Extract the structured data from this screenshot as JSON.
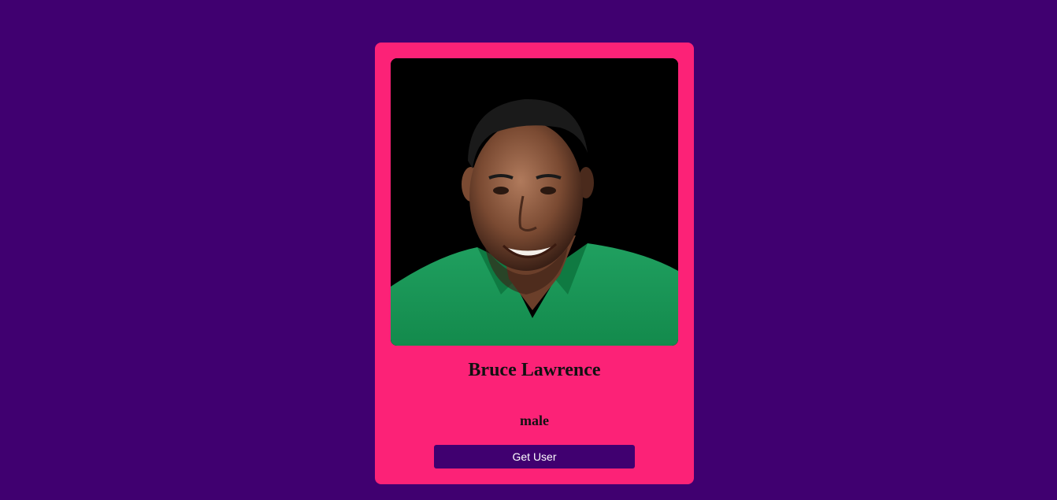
{
  "user": {
    "name": "Bruce Lawrence",
    "gender": "male"
  },
  "actions": {
    "get_user_label": "Get User"
  },
  "colors": {
    "background": "#400070",
    "card": "#fc2277",
    "button": "#400070",
    "button_text": "#ffffff"
  }
}
